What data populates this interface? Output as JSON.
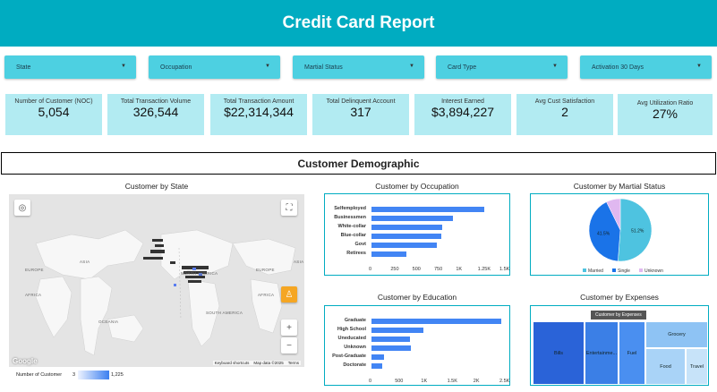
{
  "title": "Credit Card Report",
  "filters": [
    {
      "label": "State"
    },
    {
      "label": "Occupation"
    },
    {
      "label": "Martial Status"
    },
    {
      "label": "Card Type"
    },
    {
      "label": "Activation 30 Days"
    }
  ],
  "kpis": [
    {
      "label": "Number of Customer (NOC)",
      "value": "5,054"
    },
    {
      "label": "Total Transaction Volume",
      "value": "326,544"
    },
    {
      "label": "Total Transaction Amount",
      "value": "$22,314,344"
    },
    {
      "label": "Total Delinquent Account",
      "value": "317"
    },
    {
      "label": "Interest Earned",
      "value": "$3,894,227"
    },
    {
      "label": "Avg Cust Satisfaction",
      "value": "2"
    },
    {
      "label": "Avg Utilization Ratio",
      "value": "27%"
    }
  ],
  "section_title": "Customer Demographic",
  "map": {
    "title": "Customer by State",
    "google": "Google",
    "shortcuts": "Keyboard shortcuts",
    "map_data": "Map data ©2025",
    "terms": "Terms",
    "legend_label": "Number of Customer",
    "legend_min": "3",
    "legend_max": "1,225",
    "zoom_in": "+",
    "zoom_out": "−",
    "labels": {
      "europe_l": "EUROPE",
      "asia": "ASIA",
      "europe_r": "EUROPE",
      "africa_l": "AFRICA",
      "africa_r": "AFRICA",
      "north_america": "NORTH AMERICA",
      "south_america": "SOUTH AMERICA",
      "oceania": "OCEANIA",
      "asia_r": "ASIA"
    },
    "icons": {
      "locate": "locate-icon",
      "fullscreen": "fullscreen-icon",
      "pegman": "pegman-icon"
    }
  },
  "chart_data": [
    {
      "type": "bar",
      "title": "Customer by Occupation",
      "categories": [
        "Selfemployed",
        "Businessmen",
        "White-collar",
        "Blue-collar",
        "Govt",
        "Retirees"
      ],
      "values": [
        1290,
        935,
        815,
        800,
        745,
        400
      ],
      "xticks": [
        "0",
        "250",
        "500",
        "750",
        "1K",
        "1.25K",
        "1.5K"
      ],
      "xlim": [
        0,
        1500
      ],
      "color": "#4285f4"
    },
    {
      "type": "pie",
      "title": "Customer by Martial Status",
      "categories": [
        "Married",
        "Single",
        "Unknown"
      ],
      "values": [
        51.2,
        41.5,
        7.3
      ],
      "data_labels": [
        "51.2%",
        "41.5%",
        ""
      ],
      "colors": [
        "#4ec3e0",
        "#1a73e8",
        "#e0b8f0"
      ],
      "legend": "bottom"
    },
    {
      "type": "bar",
      "title": "Customer by Education",
      "categories": [
        "Graduate",
        "High School",
        "Uneducated",
        "Unknown",
        "Post-Graduate",
        "Doctorate"
      ],
      "values": [
        2480,
        1000,
        740,
        760,
        240,
        210
      ],
      "xticks": [
        "0",
        "500",
        "1K",
        "1.5K",
        "2K",
        "2.5K"
      ],
      "xlim": [
        0,
        2500
      ],
      "color": "#4285f4"
    },
    {
      "type": "treemap",
      "title": "Customer by Expenses",
      "header": "Customer by Expenses",
      "categories": [
        "Bills",
        "Entertainme...",
        "Fuel",
        "Grocery",
        "Food",
        "Travel"
      ],
      "colors": [
        "#2a63d8",
        "#3b7fe6",
        "#4a8ff0",
        "#8ec3f4",
        "#a9d3f7",
        "#c7e3f9"
      ]
    }
  ]
}
